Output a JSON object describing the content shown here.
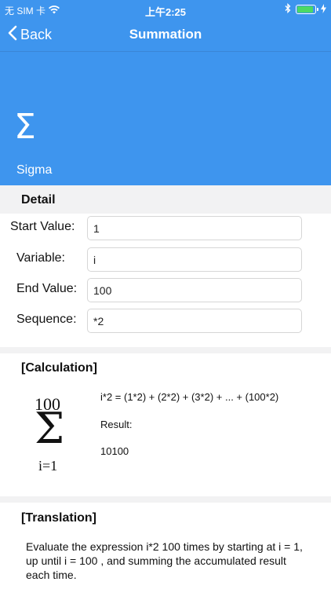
{
  "status_bar": {
    "carrier": "无 SIM 卡",
    "time": "上午2:25",
    "battery_level": 0.95
  },
  "nav": {
    "back_label": "Back",
    "title": "Summation"
  },
  "hero": {
    "symbol": "Σ",
    "label": "Sigma"
  },
  "detail": {
    "header": "Detail",
    "fields": [
      {
        "label": "Start Value:",
        "value": "1"
      },
      {
        "label": "Variable:",
        "value": "i"
      },
      {
        "label": "End Value:",
        "value": "100"
      },
      {
        "label": "Sequence:",
        "value": "*2"
      }
    ]
  },
  "calculation": {
    "title": "[Calculation]",
    "upper_limit": "100",
    "sigma": "Σ",
    "lower_limit": "i=1",
    "expansion": "i*2 =  (1*2) + (2*2) + (3*2) +  ...  +  (100*2)",
    "result_label": "Result:",
    "result_value": "10100"
  },
  "translation": {
    "title": "[Translation]",
    "text": "Evaluate the expression i*2 100 times by starting at i = 1, up until i = 100 , and summing the accumulated result each time."
  },
  "colors": {
    "accent": "#3e95ee",
    "section_bg": "#f2f2f3",
    "battery_fill": "#4cd964"
  }
}
